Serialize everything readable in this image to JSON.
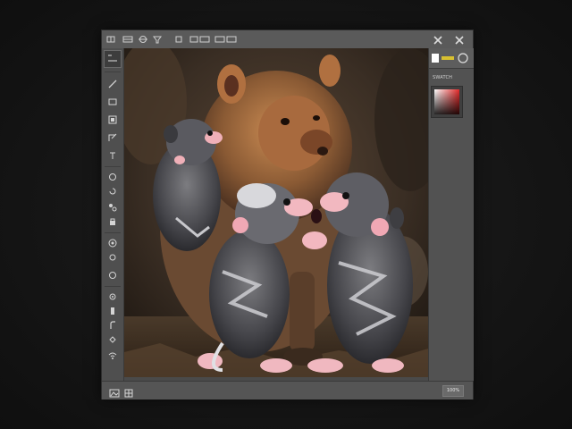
{
  "topbar": {
    "items": [
      "⊞",
      "▤",
      "◈",
      "◇",
      "◻",
      "▦▦",
      "▥▥"
    ],
    "close_icons": [
      "close-icon",
      "close-icon"
    ]
  },
  "left_toolbar": {
    "tools": [
      "selection-tool-icon",
      "brush-tool-icon",
      "layers-tool-icon",
      "crop-tool-icon",
      "transform-tool-icon",
      "text-tool-icon",
      "clone-tool-icon",
      "history-tool-icon",
      "node-tool-icon",
      "lock-tool-icon",
      "circle-select-icon",
      "dot-tool-icon",
      "ellipse-tool-icon",
      "gear-tool-icon",
      "pen-tool-icon",
      "hook-tool-icon",
      "fill-tool-icon",
      "wifi-tool-icon"
    ]
  },
  "right_panel": {
    "title": "SWATCH",
    "swatch_colors": [
      "#ffffff",
      "#e52a2a",
      "#000000"
    ]
  },
  "canvas": {
    "subject": "photo",
    "palette": [
      "#3a2e24",
      "#7a4e2c",
      "#c08050",
      "#2a2a2a",
      "#d9d9d9",
      "#f2b8c0"
    ]
  },
  "bottombar": {
    "left_icons": [
      "image-icon",
      "grid-icon"
    ],
    "zoom_label": "100%"
  }
}
